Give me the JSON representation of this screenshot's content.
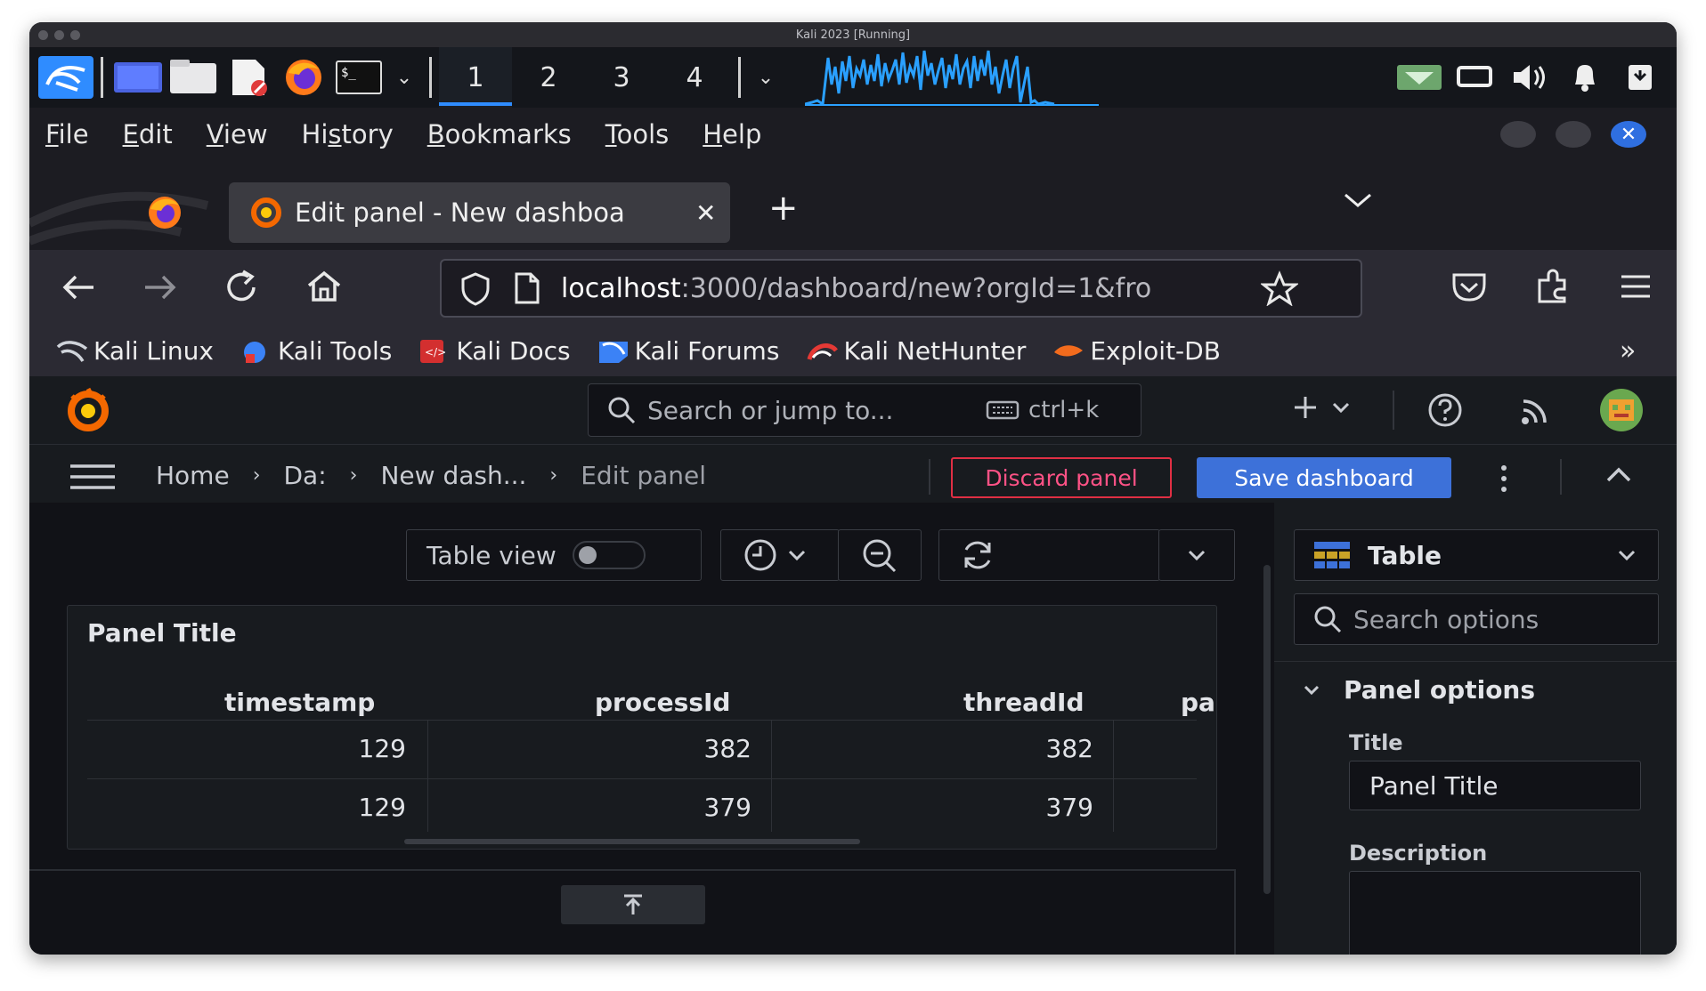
{
  "window": {
    "title": "Kali 2023 [Running]"
  },
  "taskbar": {
    "workspaces": [
      "1",
      "2",
      "3",
      "4"
    ],
    "active_workspace": "1",
    "accent": "#2f8cff"
  },
  "menu": {
    "items": [
      {
        "label": "File",
        "u": "F",
        "rest": "ile"
      },
      {
        "label": "Edit",
        "u": "E",
        "rest": "dit"
      },
      {
        "label": "View",
        "u": "V",
        "rest": "iew"
      },
      {
        "label": "History",
        "pre": "Hi",
        "u": "s",
        "rest": "tory"
      },
      {
        "label": "Bookmarks",
        "u": "B",
        "rest": "ookmarks"
      },
      {
        "label": "Tools",
        "u": "T",
        "rest": "ools"
      },
      {
        "label": "Help",
        "u": "H",
        "rest": "elp"
      }
    ]
  },
  "tabs": {
    "active_title": "Edit panel - New dashboa",
    "new_tab": "+"
  },
  "address": {
    "host": "localhost",
    "rest": ":3000/dashboard/new?orgId=1&fro"
  },
  "bookmarks": [
    "Kali Linux",
    "Kali Tools",
    "Kali Docs",
    "Kali Forums",
    "Kali NetHunter",
    "Exploit-DB"
  ],
  "grafana": {
    "search_placeholder": "Search or jump to...",
    "search_shortcut": "ctrl+k",
    "breadcrumb": [
      "Home",
      "Da:",
      "New dash...",
      "Edit panel"
    ],
    "discard_label": "Discard panel",
    "save_label": "Save dashboard",
    "table_view_label": "Table view",
    "table_view_on": false,
    "visualization": "Table",
    "options_search_placeholder": "Search options",
    "panel_options_heading": "Panel options",
    "title_label": "Title",
    "title_value": "Panel Title",
    "description_label": "Description",
    "description_value": ""
  },
  "panel": {
    "title": "Panel Title",
    "columns": [
      "timestamp",
      "processId",
      "threadId",
      "pa"
    ],
    "rows": [
      [
        "129",
        "382",
        "382",
        ""
      ],
      [
        "129",
        "379",
        "379",
        ""
      ]
    ]
  },
  "colors": {
    "discard": "#e02f44",
    "save": "#3d71d9",
    "grafana_bg": "#111217",
    "panel_bg": "#181b1f"
  }
}
